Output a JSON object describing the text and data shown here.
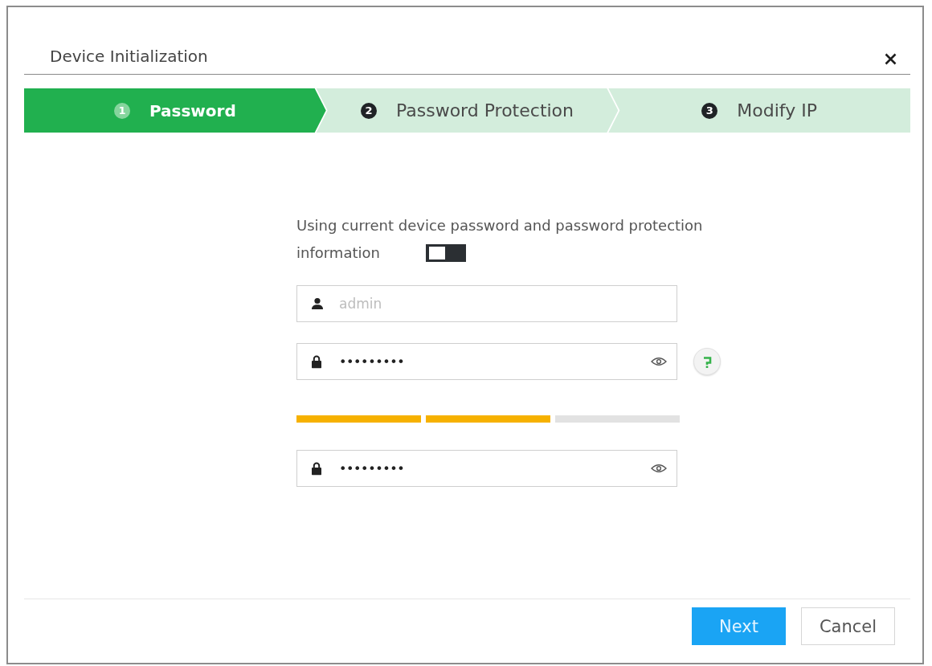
{
  "dialog": {
    "title": "Device Initialization"
  },
  "steps": [
    {
      "number": "1",
      "label": "Password",
      "selected": true
    },
    {
      "number": "2",
      "label": "Password Protection",
      "selected": false
    },
    {
      "number": "3",
      "label": "Modify IP",
      "selected": false
    }
  ],
  "form": {
    "option": {
      "label_lines": [
        "Using current device password and password protection",
        "information"
      ],
      "on": false
    },
    "rows": [
      {
        "kind": "username",
        "placeholder": "admin"
      },
      {
        "kind": "password",
        "value": "•••••••••",
        "help": true
      },
      {
        "kind": "strength",
        "level": 0.67
      },
      {
        "kind": "password",
        "value": "•••••••••"
      }
    ]
  },
  "buttons": [
    {
      "kind": "next",
      "label": "Next"
    },
    {
      "kind": "cancel",
      "label": "Cancel"
    }
  ]
}
